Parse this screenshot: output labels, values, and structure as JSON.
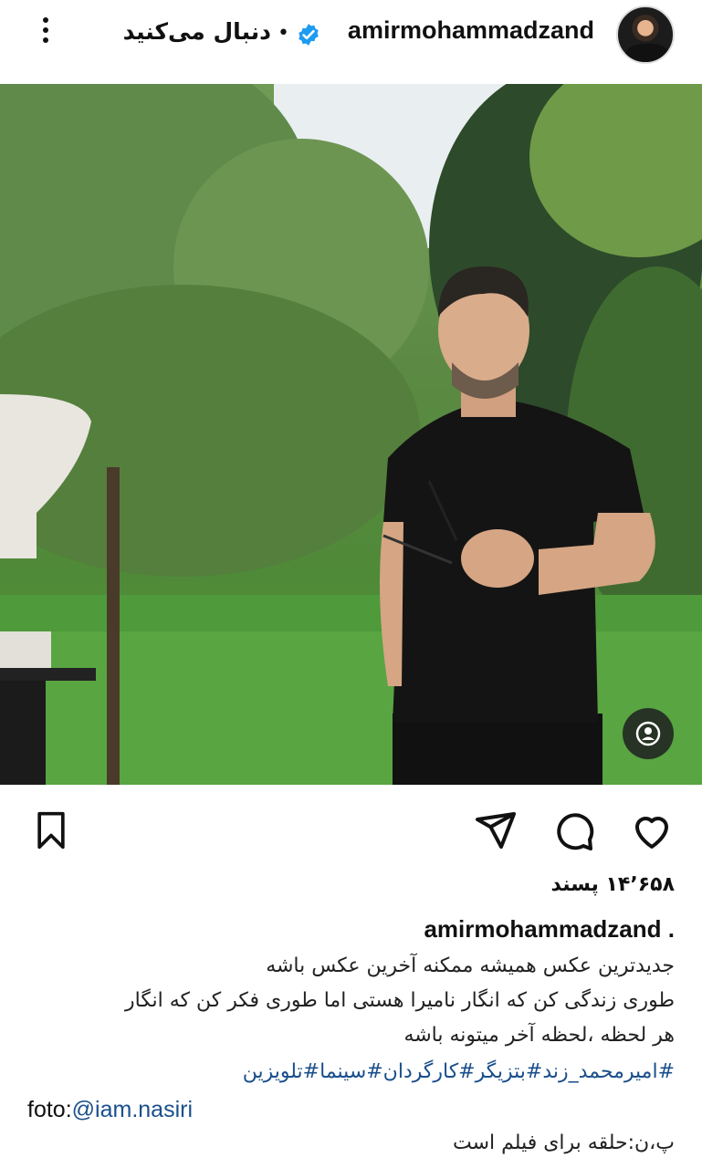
{
  "header": {
    "username": "amirmohammadzand",
    "follow_label": "دنبال می‌کنید",
    "separator": "•",
    "more_icon": "more-vertical-icon",
    "verified_icon": "verified-badge-icon"
  },
  "post": {
    "image_alt": "man-in-black-tshirt-in-garden",
    "tag_icon": "user-tag-icon"
  },
  "actions": {
    "like_icon": "heart-icon",
    "comment_icon": "comment-icon",
    "share_icon": "send-icon",
    "save_icon": "bookmark-icon"
  },
  "likes_text": "۱۴٬۶۵۸ پسند",
  "caption": {
    "username": "amirmohammadzand",
    "username_suffix": " .",
    "lines": [
      "جدیدترین عکس همیشه ممکنه آخرین عکس باشه",
      "طوری زندگی کن که انگار نامیرا هستی اما طوری فکر کن که انگار",
      "هر لحظه ،لحظه آخر میتونه باشه"
    ],
    "hashtags": "#امیرمحمد_زند#بتزیگر#کارگردان#سینما#تلویزین",
    "photo_credit_prefix": "foto:",
    "photo_credit_handle": "@iam.nasiri",
    "ps": "پ،ن:حلقه برای فیلم است"
  },
  "colors": {
    "verified": "#1d9bf0",
    "link": "#1a4f8c",
    "text": "#111111"
  }
}
